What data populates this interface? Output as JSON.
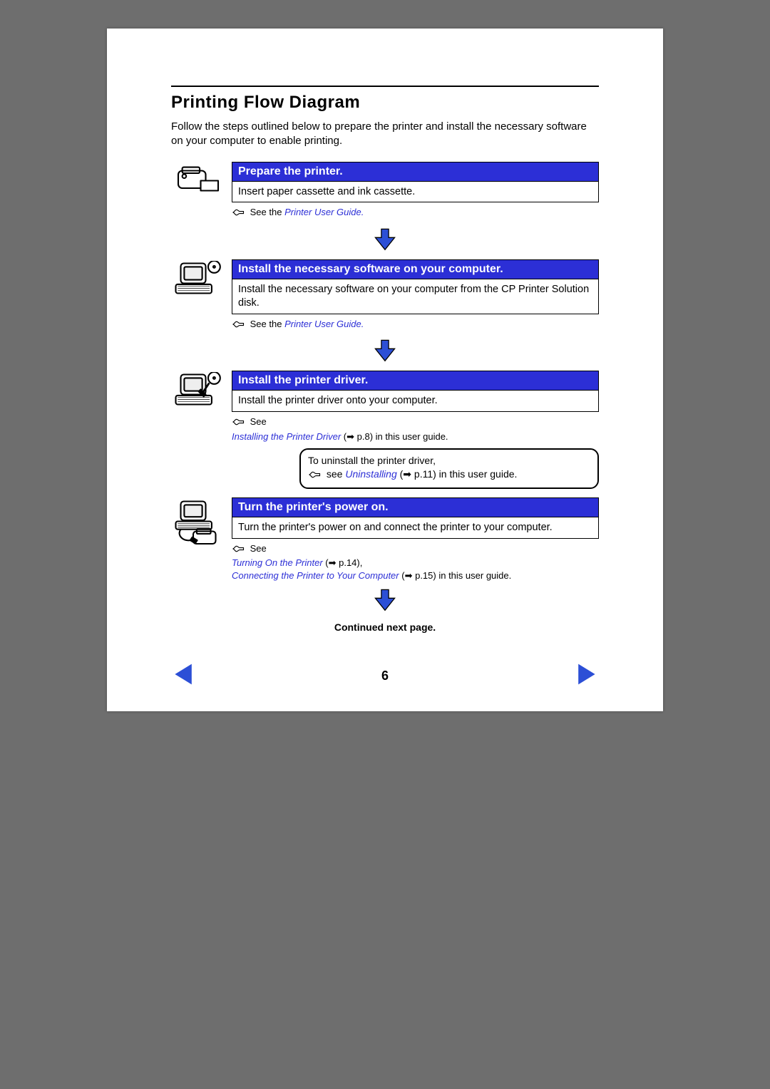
{
  "title": "Printing Flow Diagram",
  "intro": "Follow the steps outlined below to prepare the printer and install the necessary software on your computer to enable printing.",
  "steps": {
    "s1": {
      "head": "Prepare the printer.",
      "body": "Insert paper cassette and ink cassette.",
      "see_prefix": "See the ",
      "see_link": "Printer User Guide."
    },
    "s2": {
      "head": "Install the necessary software on your computer.",
      "body": "Install the necessary software on your computer from the CP Printer Solution disk.",
      "see_prefix": "See the ",
      "see_link": "Printer User Guide."
    },
    "s3": {
      "head": "Install the printer driver.",
      "body": "Install the printer driver onto your computer.",
      "see_prefix": "See",
      "link1": "Installing the Printer Driver",
      "link1_ref": "(➡ p.8)",
      "link1_tail": " in this user guide."
    },
    "s4": {
      "head": "Turn the printer's power on.",
      "body": "Turn the printer's power on and connect the printer to your computer.",
      "see_prefix": "See",
      "link1": "Turning On the Printer",
      "link1_ref": "(➡ p.14)",
      "link1_sep": ",",
      "link2": "Connecting the Printer to Your Computer",
      "link2_ref": "(➡ p.15)",
      "link2_tail": " in this user guide."
    }
  },
  "tip": {
    "line1": "To uninstall the printer driver,",
    "see": " see ",
    "link": "Uninstalling",
    "ref": "(➡ p.11)",
    "tail": " in this user guide."
  },
  "continued": "Continued next page.",
  "page_number": "6"
}
